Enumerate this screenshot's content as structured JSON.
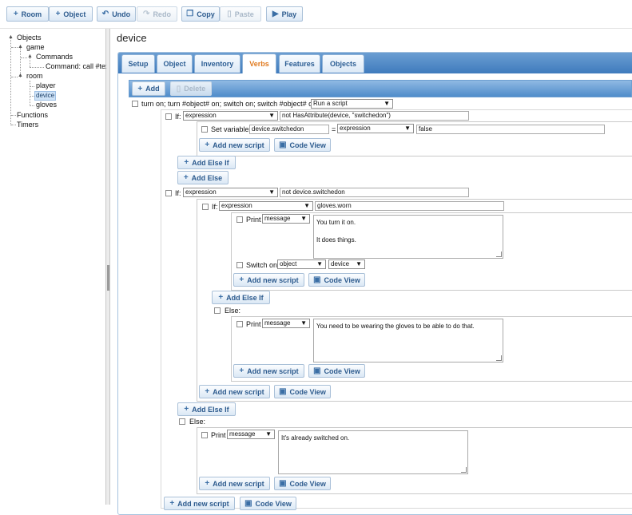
{
  "toolbar": {
    "room": "Room",
    "object": "Object",
    "undo": "Undo",
    "redo": "Redo",
    "copy": "Copy",
    "paste": "Paste",
    "play": "Play"
  },
  "tree": {
    "objects": "Objects",
    "game": "game",
    "commands": "Commands",
    "command_call": "Command: call #tex",
    "room": "room",
    "player": "player",
    "device": "device",
    "gloves": "gloves",
    "functions": "Functions",
    "timers": "Timers"
  },
  "editor": {
    "title": "device",
    "tabs": [
      "Setup",
      "Object",
      "Inventory",
      "Verbs",
      "Features",
      "Objects"
    ],
    "active_tab": "Verbs",
    "add": "Add",
    "delete": "Delete",
    "verb_pattern": "turn on; turn #object# on; switch on; switch #object# on",
    "verb_action": "Run a script"
  },
  "labels": {
    "if": "If:",
    "else": "Else:",
    "print": "Print",
    "set_variable": "Set variable",
    "switch_on": "Switch on",
    "expression": "expression",
    "message": "message",
    "object": "object",
    "device": "device",
    "equals": "=",
    "add_new_script": "Add new script",
    "code_view": "Code View",
    "add_else_if": "Add Else If",
    "add_else": "Add Else"
  },
  "script": {
    "if1_expr": "not HasAttribute(device, \"switchedon\")",
    "setvar_name": "device.switchedon",
    "setvar_value": "false",
    "if2_expr": "not device.switchedon",
    "if3_expr": "gloves.worn",
    "print1": "You turn it on.\n\nIt does things.",
    "print2": "You need to be wearing the gloves to be able to do that.",
    "print3": "It's already switched on."
  }
}
